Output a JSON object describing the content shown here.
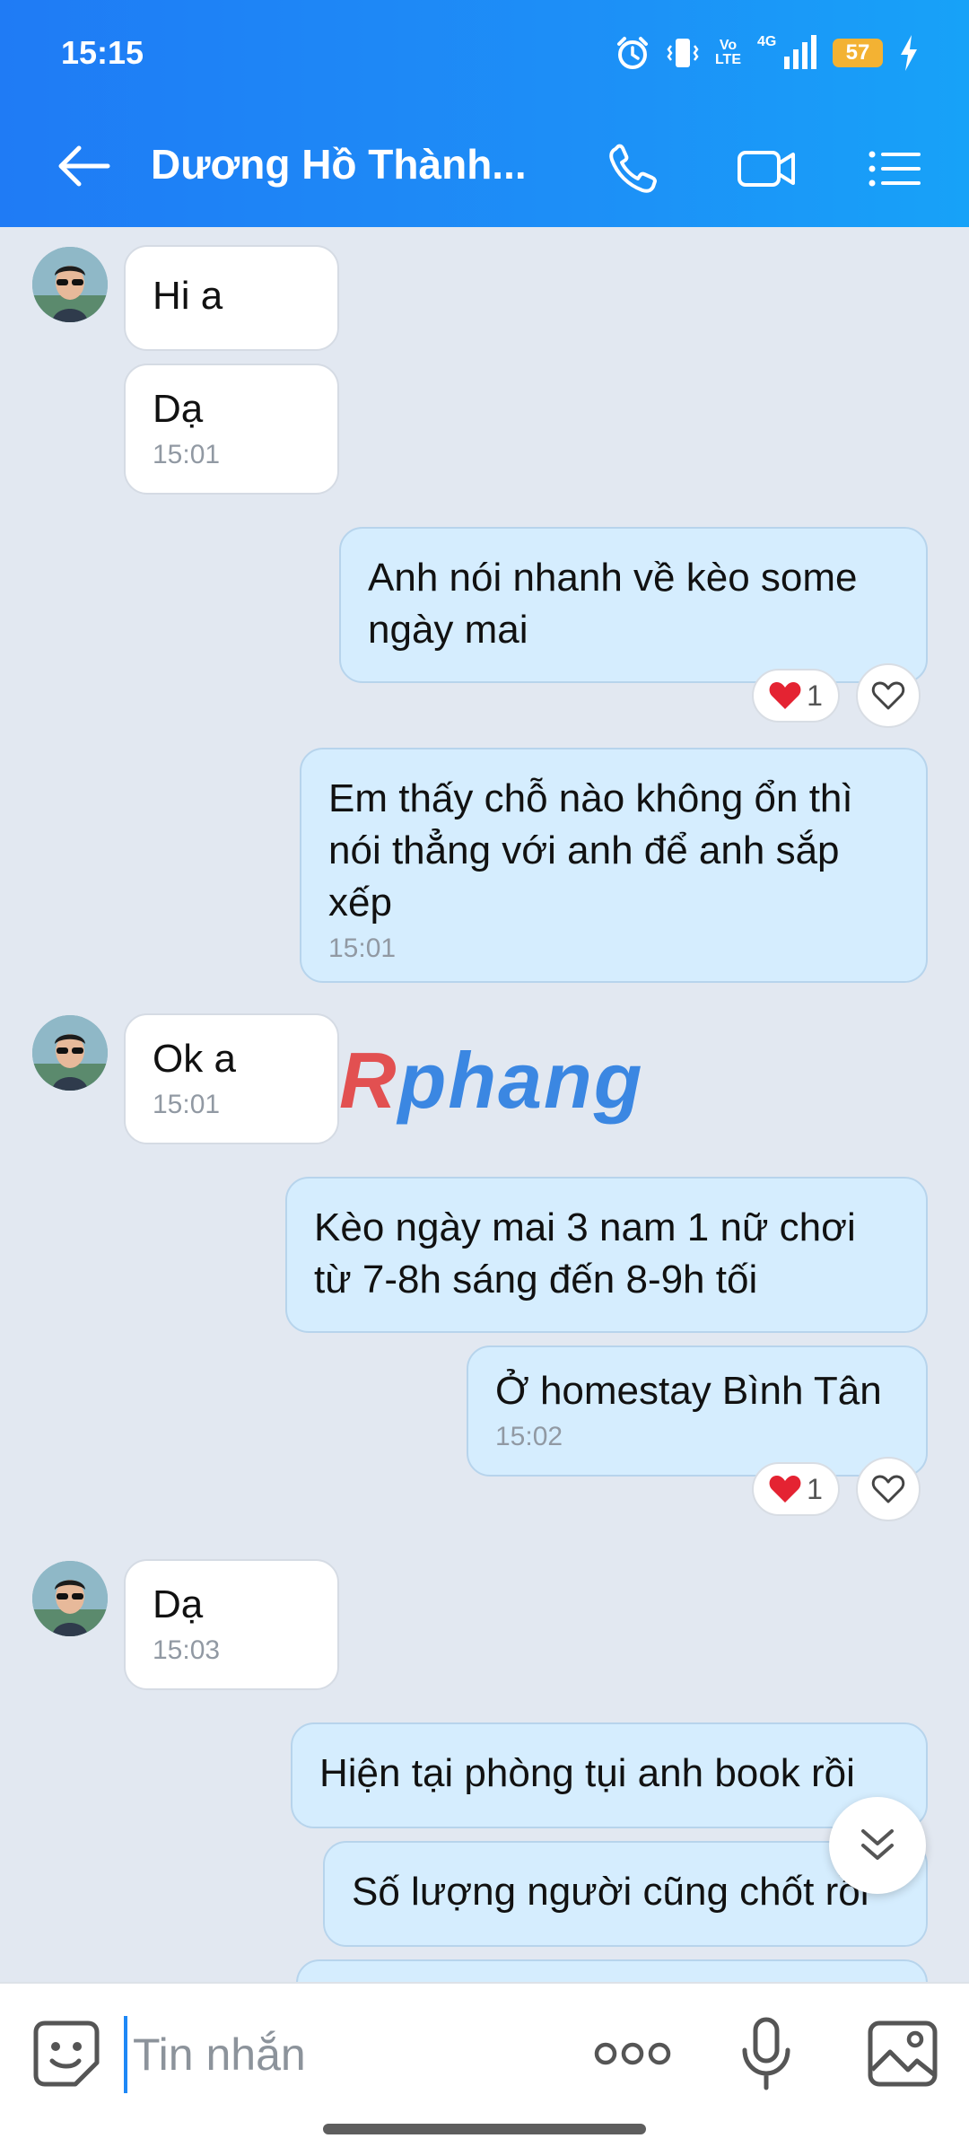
{
  "status_bar": {
    "time": "15:15",
    "volte": [
      "Vo",
      "LTE"
    ],
    "network": "4G",
    "battery": "57"
  },
  "header": {
    "contact_name": "Dương Hồ Thành...",
    "accent_color": "#1f7bf5"
  },
  "messages": [
    {
      "side": "in",
      "text": "Hi a"
    },
    {
      "side": "in",
      "text": "Dạ",
      "time": "15:01"
    },
    {
      "side": "out",
      "text": "Anh nói nhanh về kèo some ngày mai",
      "reaction_count": "1"
    },
    {
      "side": "out",
      "text": "Em thấy chỗ nào không ổn thì nói thẳng với anh để anh sắp xếp",
      "time": "15:01"
    },
    {
      "side": "in",
      "text": "Ok a",
      "time": "15:01"
    },
    {
      "side": "out",
      "text": "Kèo ngày mai 3 nam 1 nữ chơi từ 7-8h sáng đến 8-9h tối"
    },
    {
      "side": "out",
      "text": "Ở homestay Bình Tân",
      "time": "15:02",
      "reaction_count": "1"
    },
    {
      "side": "in",
      "text": "Dạ",
      "time": "15:03"
    },
    {
      "side": "out",
      "text": "Hiện tại phòng tụi anh book rồi"
    },
    {
      "side": "out",
      "text": "Số lượng người cũng chốt rồi"
    }
  ],
  "watermark": {
    "first": "R",
    "rest": "phang"
  },
  "composer": {
    "placeholder": "Tin nhắn"
  },
  "icons": {
    "back": "arrow-left-icon",
    "call": "phone-icon",
    "video": "video-camera-icon",
    "menu": "list-menu-icon",
    "sticker": "smiley-sticker-icon",
    "more": "more-dots-icon",
    "mic": "microphone-icon",
    "gallery": "image-gallery-icon",
    "scroll": "double-chevron-down-icon",
    "reaction": "red-heart-icon",
    "like": "heart-outline-icon"
  }
}
